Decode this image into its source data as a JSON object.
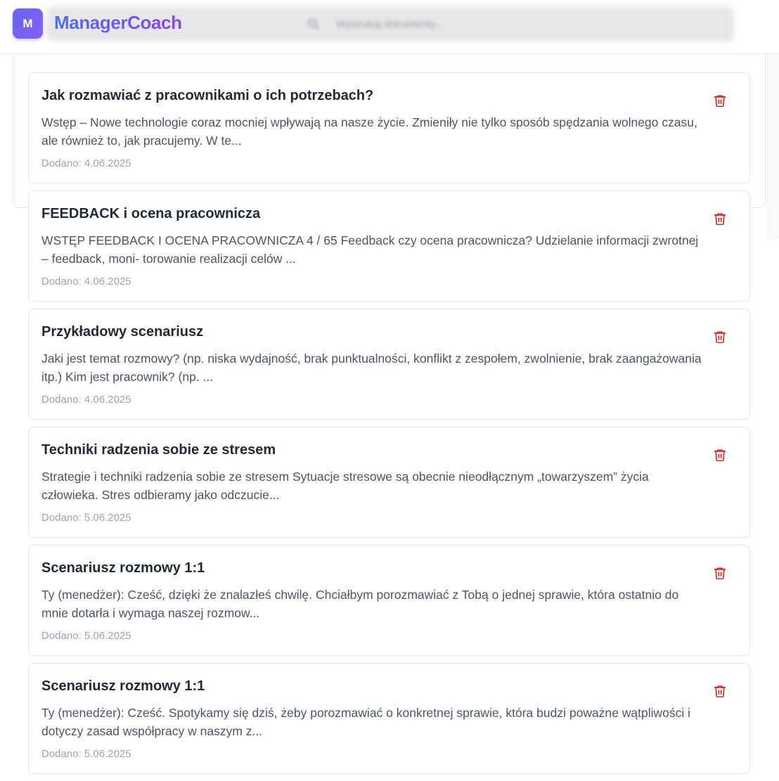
{
  "app": {
    "logo_letter": "M",
    "name": "ManagerCoach",
    "search_placeholder": "Wyszukaj dokumenty..."
  },
  "colors": {
    "brand_start": "#6366f1",
    "brand_end": "#8b5cf6",
    "delete": "#dc2626"
  },
  "documents": [
    {
      "title": "Jak rozmawiać z pracownikami o ich potrzebach?",
      "excerpt": "Wstęp – Nowe technologie coraz mocniej wpływają na nasze życie. Zmieniły nie tylko sposób spędzania wolnego czasu, ale również to, jak pracujemy. W te...",
      "date": "Dodano: 4.06.2025",
      "action_icon": "trash-icon"
    },
    {
      "title": "FEEDBACK i ocena pracownicza",
      "excerpt": "WSTĘP FEEDBACK I OCENA PRACOWNICZA 4 / 65 Feedback czy ocena pracownicza? Udzielanie informacji zwrotnej – feedback, moni- torowanie realizacji celów ...",
      "date": "Dodano: 4.06.2025",
      "action_icon": "trash-icon"
    },
    {
      "title": "Przykładowy scenariusz",
      "excerpt": "Jaki jest temat rozmowy? (np. niska wydajność, brak punktualności, konflikt z zespołem, zwolnienie, brak zaangażowania itp.) Kim jest pracownik? (np. ...",
      "date": "Dodano: 4.06.2025",
      "action_icon": "trash-icon"
    },
    {
      "title": "Techniki radzenia sobie ze stresem",
      "excerpt": "Strategie i techniki radzenia sobie ze stresem Sytuacje stresowe są obecnie nieodłącznym „towarzyszem” życia człowieka. Stres odbieramy jako odczucie...",
      "date": "Dodano: 5.06.2025",
      "action_icon": "trash-icon"
    },
    {
      "title": "Scenariusz rozmowy 1:1",
      "excerpt": "Ty (menedżer): Cześć, dzięki że znalazłeś chwilę. Chciałbym porozmawiać z Tobą o jednej sprawie, która ostatnio do mnie dotarła i wymaga naszej rozmow...",
      "date": "Dodano: 5.06.2025",
      "action_icon": "trash-icon"
    },
    {
      "title": "Scenariusz rozmowy 1:1",
      "excerpt": "Ty (menedżer): Cześć. Spotykamy się dziś, żeby porozmawiać o konkretnej sprawie, która budzi poważne wątpliwości i dotyczy zasad współpracy w naszym z...",
      "date": "Dodano: 5.06.2025",
      "action_icon": "trash-icon"
    }
  ]
}
